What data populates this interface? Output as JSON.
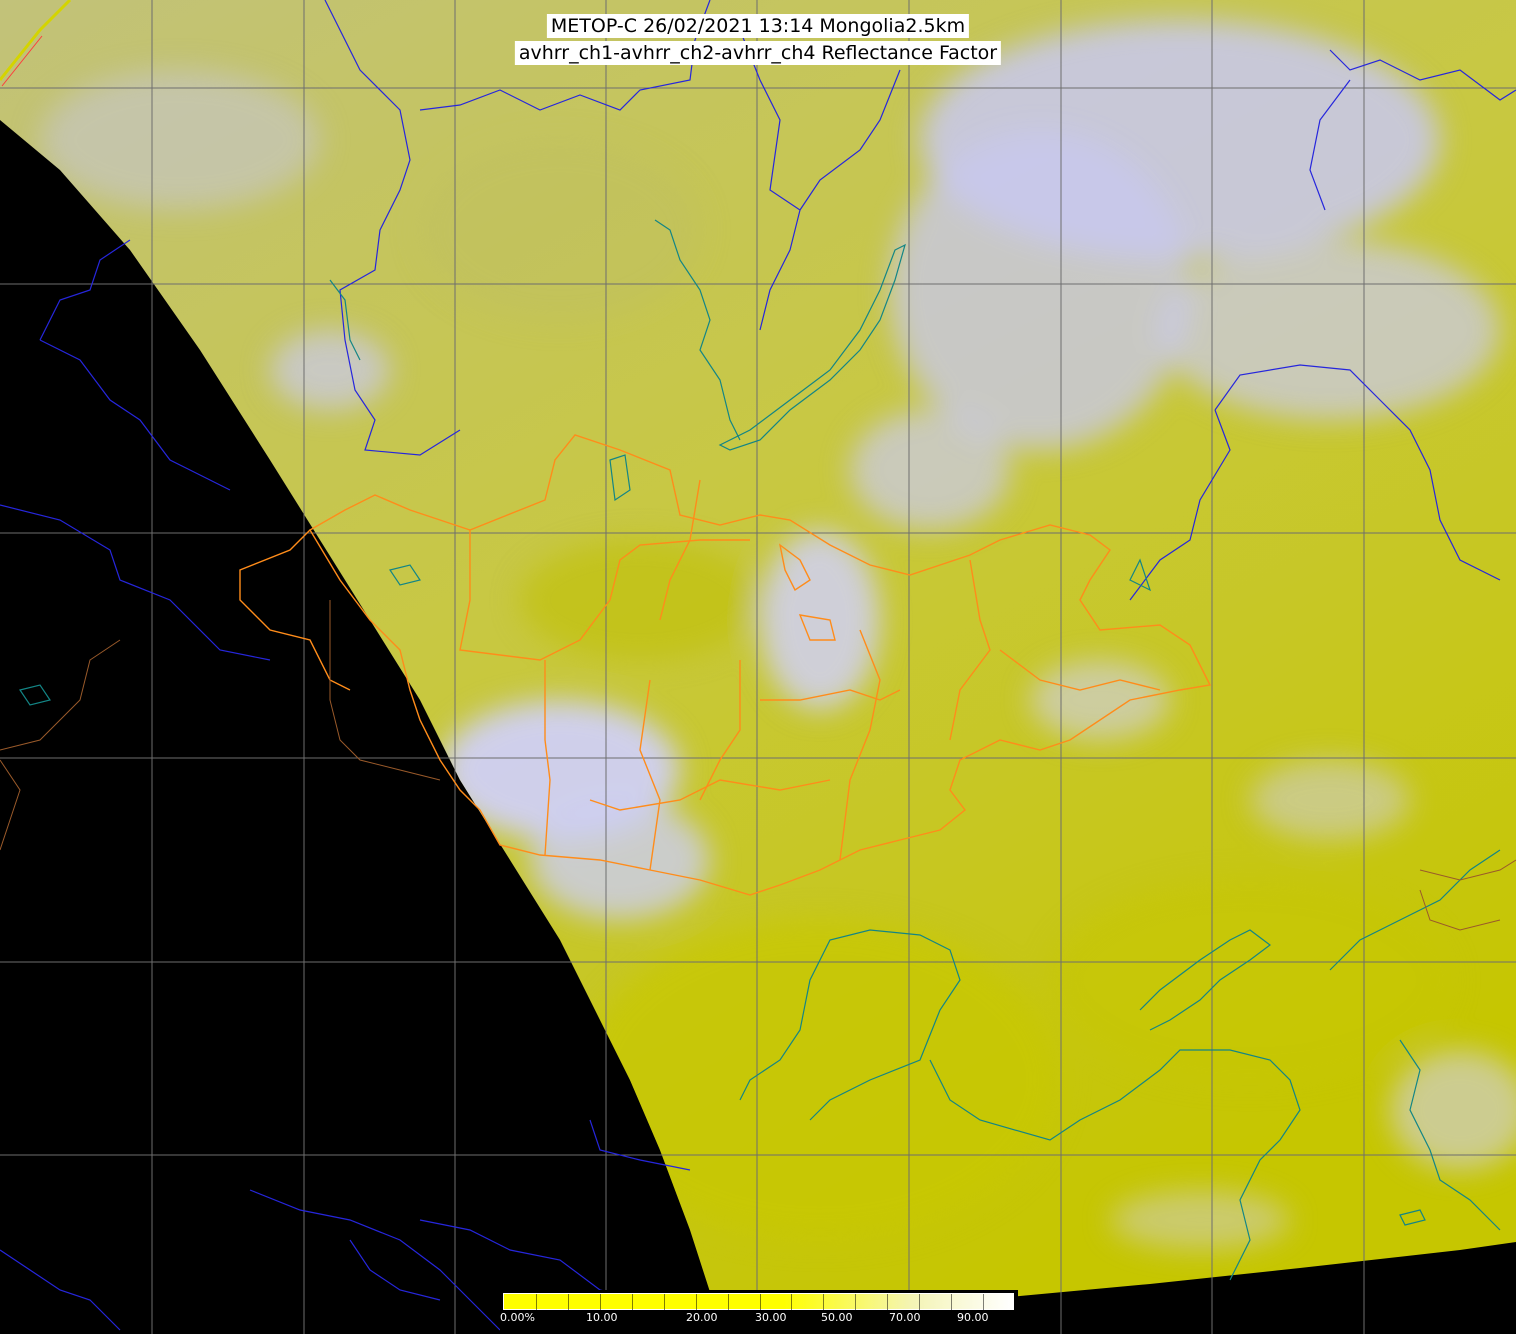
{
  "title": {
    "line1": "METOP-C 26/02/2021 13:14 Mongolia2.5km",
    "line2": "avhrr_ch1-avhrr_ch2-avhrr_ch4 Reflectance Factor"
  },
  "colors": {
    "background": "#000000",
    "surface_yellow": "#c8c800",
    "cloud_lavender": "#c4c4ee",
    "grid": "#707070",
    "rivers": "#2a2ae0",
    "coast": "#148a8a",
    "mongolia_borders": "#ff8c00",
    "colorbar_start": "#ffff00",
    "colorbar_end": "#ffffff"
  },
  "colorbar": {
    "labels": [
      "0.00%",
      "10.00",
      "20.00",
      "30.00",
      "50.00",
      "70.00",
      "90.00"
    ]
  }
}
